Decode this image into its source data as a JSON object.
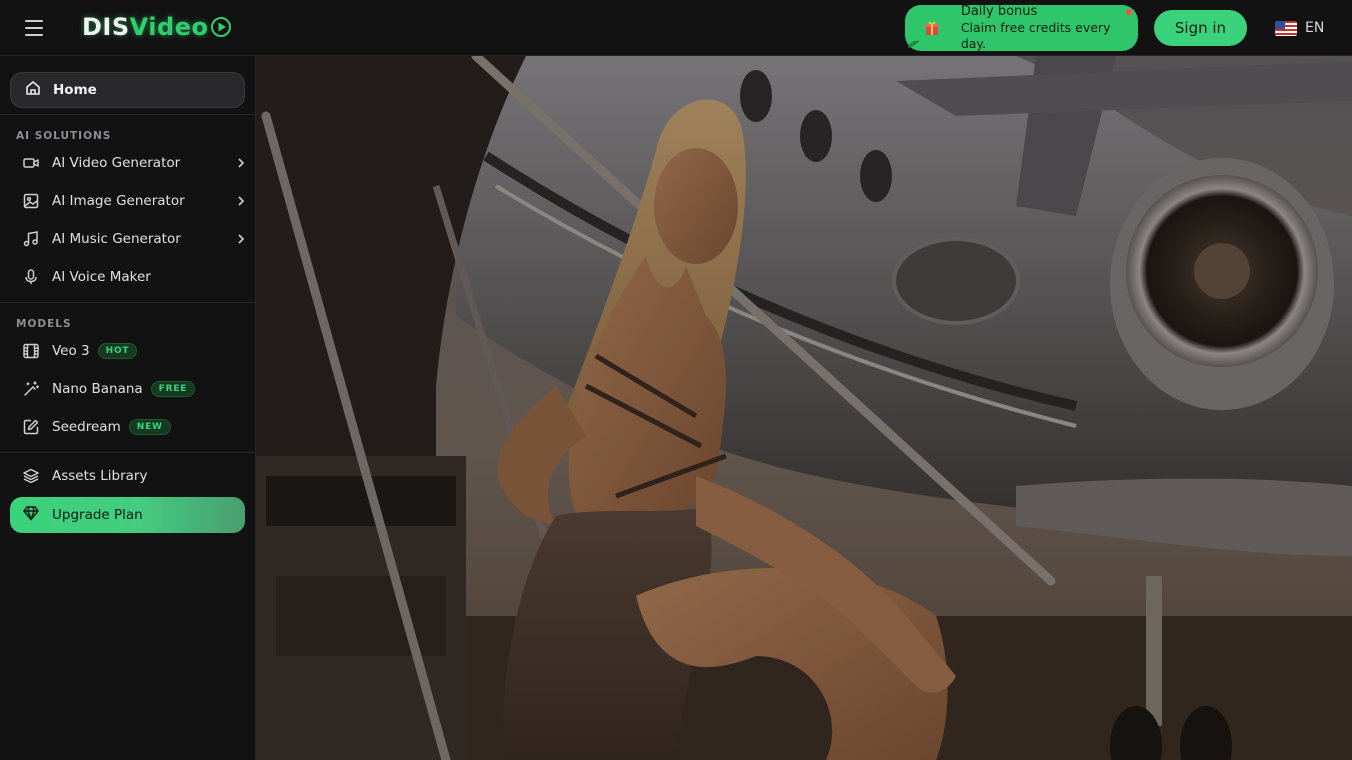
{
  "header": {
    "logo_part1": "DIS",
    "logo_part2": "Video",
    "bonus_title": "Daily bonus",
    "bonus_subtitle": "Claim free credits every day.",
    "signin_label": "Sign in",
    "language": "EN",
    "icons": [
      "hamburger-menu-icon",
      "play-icon",
      "gift-icon",
      "us-flag-icon"
    ]
  },
  "sidebar": {
    "home_label": "Home",
    "ai_solutions_title": "AI SOLUTIONS",
    "ai_solutions": [
      {
        "label": "AI Video Generator",
        "icon": "video-camera-icon"
      },
      {
        "label": "AI Image Generator",
        "icon": "image-icon"
      },
      {
        "label": "AI Music Generator",
        "icon": "music-note-icon"
      },
      {
        "label": "AI Voice Maker",
        "icon": "microphone-icon"
      }
    ],
    "models_title": "MODELS",
    "models": [
      {
        "label": "Veo 3",
        "badge": "HOT",
        "icon": "film-icon"
      },
      {
        "label": "Nano Banana",
        "badge": "FREE",
        "icon": "magic-wand-icon"
      },
      {
        "label": "Seedream",
        "badge": "NEW",
        "icon": "paint-canvas-icon"
      }
    ],
    "assets_label": "Assets Library",
    "upgrade_label": "Upgrade Plan"
  },
  "hero": {
    "image_description_icon": "hero-photo"
  },
  "colors": {
    "accent": "#3ad27b",
    "background": "#121213",
    "badge_bg": "#143a22"
  }
}
